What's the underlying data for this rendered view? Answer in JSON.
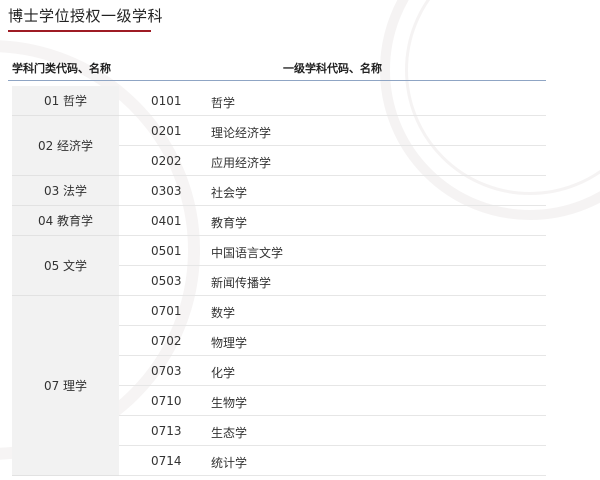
{
  "title": "博士学位授权一级学科",
  "header": {
    "col1": "学科门类代码、名称",
    "col2": "一级学科代码、名称"
  },
  "groups": [
    {
      "label": "01 哲学",
      "subjects": [
        {
          "code": "0101",
          "name": "哲学"
        }
      ]
    },
    {
      "label": "02 经济学",
      "subjects": [
        {
          "code": "0201",
          "name": "理论经济学"
        },
        {
          "code": "0202",
          "name": "应用经济学"
        }
      ]
    },
    {
      "label": "03 法学",
      "subjects": [
        {
          "code": "0303",
          "name": "社会学"
        }
      ]
    },
    {
      "label": "04 教育学",
      "subjects": [
        {
          "code": "0401",
          "name": "教育学"
        }
      ]
    },
    {
      "label": "05 文学",
      "subjects": [
        {
          "code": "0501",
          "name": "中国语言文学"
        },
        {
          "code": "0503",
          "name": "新闻传播学"
        }
      ]
    },
    {
      "label": "07 理学",
      "subjects": [
        {
          "code": "0701",
          "name": "数学"
        },
        {
          "code": "0702",
          "name": "物理学"
        },
        {
          "code": "0703",
          "name": "化学"
        },
        {
          "code": "0710",
          "name": "生物学"
        },
        {
          "code": "0713",
          "name": "生态学"
        },
        {
          "code": "0714",
          "name": "统计学"
        }
      ]
    }
  ]
}
